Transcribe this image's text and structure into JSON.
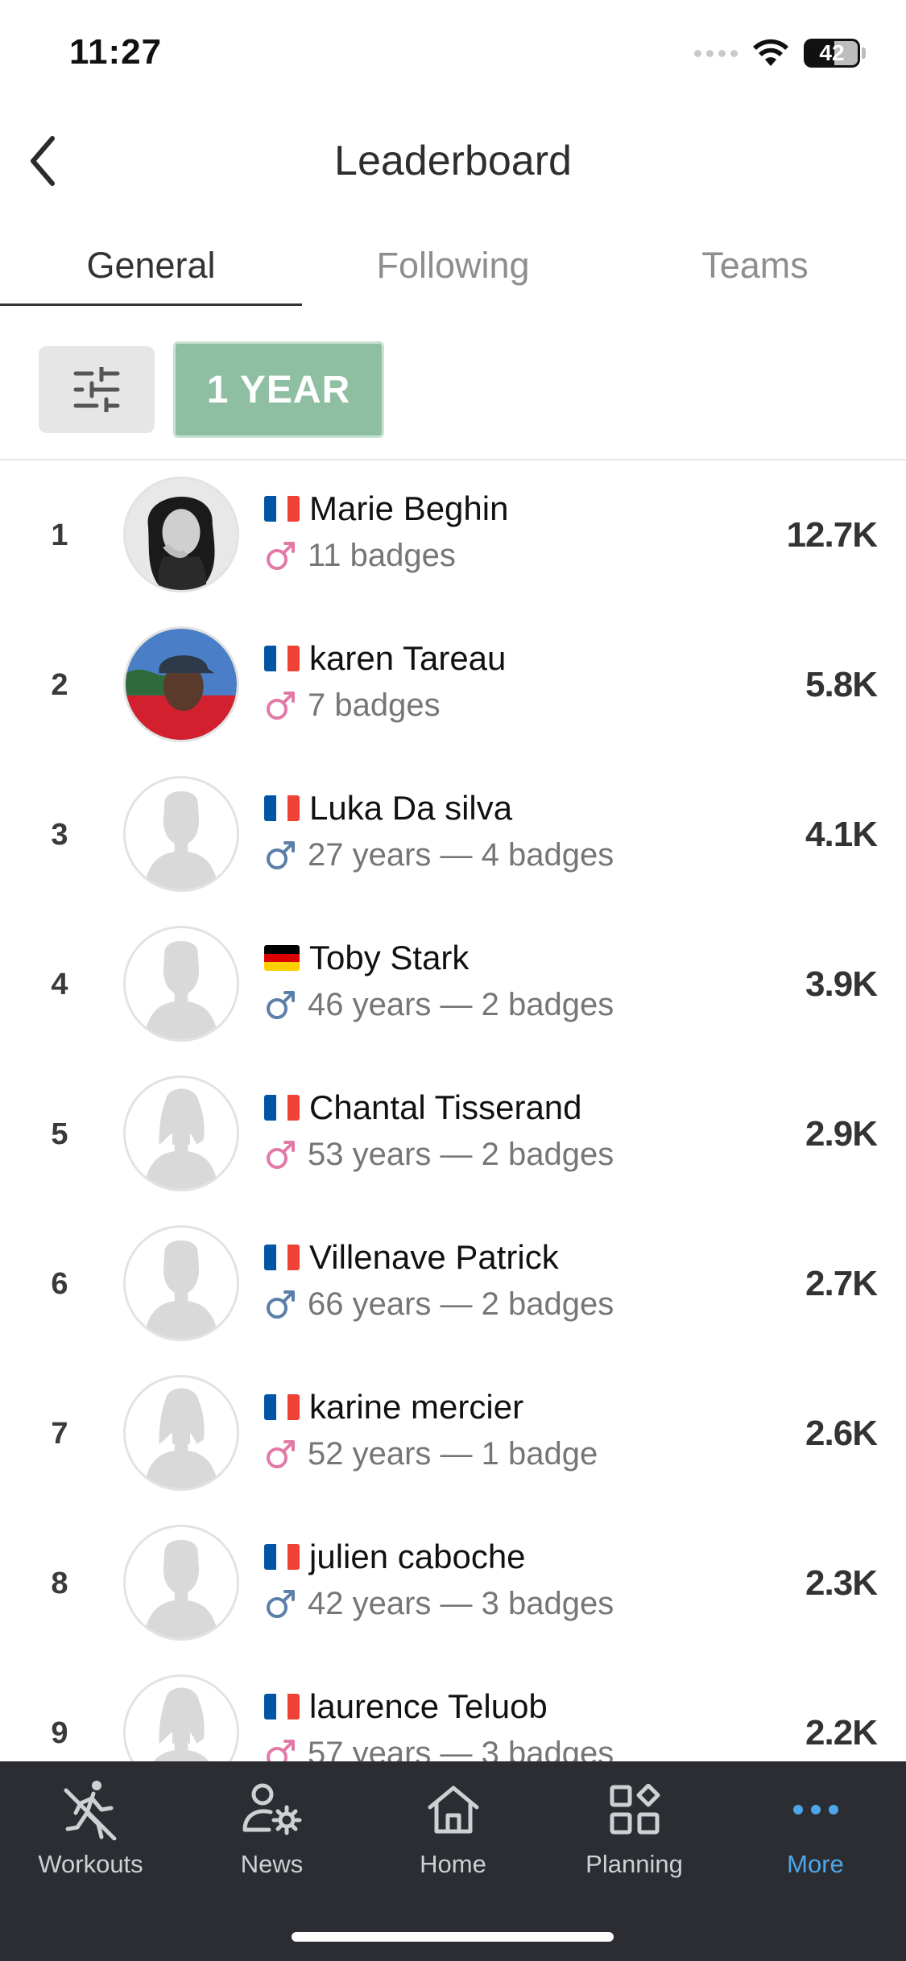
{
  "status_bar": {
    "time": "11:27",
    "battery": "42"
  },
  "header": {
    "title": "Leaderboard"
  },
  "tabs": [
    {
      "label": "General",
      "active": true
    },
    {
      "label": "Following",
      "active": false
    },
    {
      "label": "Teams",
      "active": false
    }
  ],
  "filters": {
    "period_label": "1 YEAR"
  },
  "colors": {
    "accent": "#4da6ea",
    "period_button": "#8fbfa3",
    "nav_background": "#2b2d33",
    "female_icon": "#e27aa8",
    "male_icon": "#5b7fa8"
  },
  "leaderboard": [
    {
      "rank": "1",
      "name": "Marie Beghin",
      "flag": "fr",
      "gender": "female",
      "meta": "11 badges",
      "score": "12.7K",
      "avatar": "photo-1"
    },
    {
      "rank": "2",
      "name": "karen Tareau",
      "flag": "fr",
      "gender": "female",
      "meta": "7 badges",
      "score": "5.8K",
      "avatar": "photo-2"
    },
    {
      "rank": "3",
      "name": "Luka Da silva",
      "flag": "fr",
      "gender": "male",
      "meta": "27 years — 4 badges",
      "score": "4.1K",
      "avatar": "default-male"
    },
    {
      "rank": "4",
      "name": "Toby Stark",
      "flag": "de",
      "gender": "male",
      "meta": "46 years — 2 badges",
      "score": "3.9K",
      "avatar": "default-male"
    },
    {
      "rank": "5",
      "name": "Chantal Tisserand",
      "flag": "fr",
      "gender": "female",
      "meta": "53 years — 2 badges",
      "score": "2.9K",
      "avatar": "default-female"
    },
    {
      "rank": "6",
      "name": "Villenave Patrick",
      "flag": "fr",
      "gender": "male",
      "meta": "66 years — 2 badges",
      "score": "2.7K",
      "avatar": "default-male"
    },
    {
      "rank": "7",
      "name": "karine mercier",
      "flag": "fr",
      "gender": "female",
      "meta": "52 years — 1 badge",
      "score": "2.6K",
      "avatar": "default-female"
    },
    {
      "rank": "8",
      "name": "julien caboche",
      "flag": "fr",
      "gender": "male",
      "meta": "42 years — 3 badges",
      "score": "2.3K",
      "avatar": "default-male"
    },
    {
      "rank": "9",
      "name": "laurence Teluob",
      "flag": "fr",
      "gender": "female",
      "meta": "57 years — 3 badges",
      "score": "2.2K",
      "avatar": "default-female"
    }
  ],
  "bottom_nav": [
    {
      "label": "Workouts",
      "icon": "runner-icon",
      "active": false
    },
    {
      "label": "News",
      "icon": "users-gear-icon",
      "active": false
    },
    {
      "label": "Home",
      "icon": "home-icon",
      "active": false
    },
    {
      "label": "Planning",
      "icon": "grid-icon",
      "active": false
    },
    {
      "label": "More",
      "icon": "more-dots-icon",
      "active": true
    }
  ]
}
